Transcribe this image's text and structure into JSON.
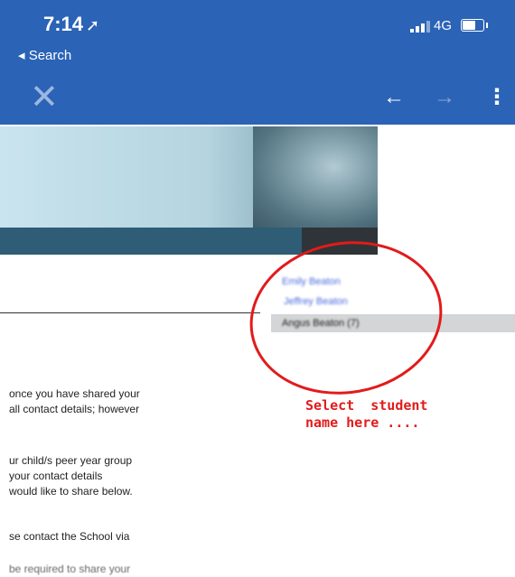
{
  "status_bar": {
    "time": "7:14",
    "location_glyph": "➚",
    "back_label": "◂ Search",
    "network": "4G",
    "icons": [
      "location-arrow-icon",
      "signal-icon",
      "battery-icon"
    ]
  },
  "toolbar": {
    "close_glyph": "✕",
    "back_glyph": "←",
    "forward_glyph": "→",
    "menu_glyph": "⋮"
  },
  "students": {
    "items": [
      "Emily Beaton",
      "Jeffrey Beaton"
    ],
    "selected": "Angus Beaton (7)"
  },
  "annotation": {
    "text": "Select  student\nname here ....",
    "color": "#e21b1b"
  },
  "body_text": {
    "p1_line1": "once you have shared your",
    "p1_line2": "all contact details; however",
    "p2_line1": "ur child/s peer year group",
    "p2_line2": "your contact details",
    "p2_line3": "would like to share below.",
    "p3_line1": "se contact the School via",
    "p4_line1": "be required to share your"
  },
  "colors": {
    "app_bar": "#2b63b6",
    "banner_strip": "#2e5d75",
    "selection_row": "#d3d5d6"
  }
}
